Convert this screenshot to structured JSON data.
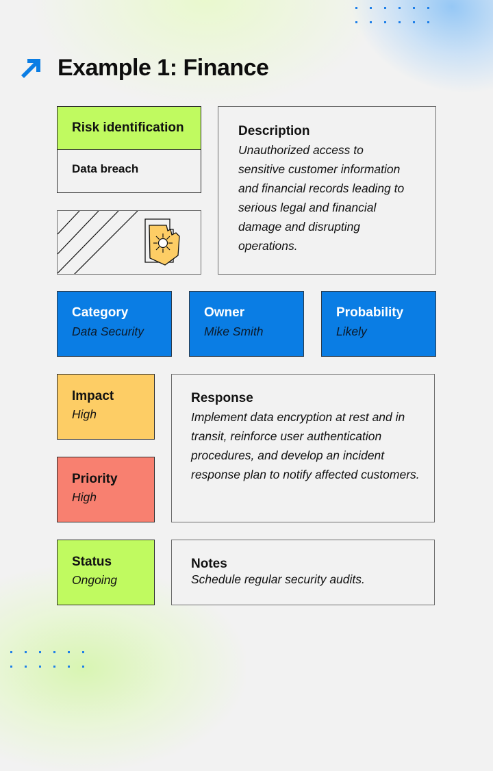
{
  "page": {
    "title": "Example 1: Finance",
    "title_icon": "arrow-up-right-icon",
    "accent_color": "#0a7de4"
  },
  "risk_identification": {
    "label": "Risk identification",
    "value": "Data breach",
    "color": "#c0fa60"
  },
  "illustration": {
    "icon": "broken-shield-icon",
    "icon_color": "#fdcd65"
  },
  "description": {
    "label": "Description",
    "text": "Unauthorized access to sensitive customer information and financial records leading to serious legal and financial damage and disrupting operations."
  },
  "category": {
    "label": "Category",
    "value": "Data Security",
    "color": "#0a7de4"
  },
  "owner": {
    "label": "Owner",
    "value": "Mike Smith",
    "color": "#0a7de4"
  },
  "probability": {
    "label": "Probability",
    "value": "Likely",
    "color": "#0a7de4"
  },
  "impact": {
    "label": "Impact",
    "value": "High",
    "color": "#fdcd65"
  },
  "priority": {
    "label": "Priority",
    "value": "High",
    "color": "#f88070"
  },
  "status": {
    "label": "Status",
    "value": "Ongoing",
    "color": "#c0fa60"
  },
  "response": {
    "label": "Response",
    "text": "Implement data encryption at rest and in transit, reinforce user authentication procedures, and develop an incident response plan to notify affected customers."
  },
  "notes": {
    "label": "Notes",
    "text": "Schedule regular security audits."
  }
}
